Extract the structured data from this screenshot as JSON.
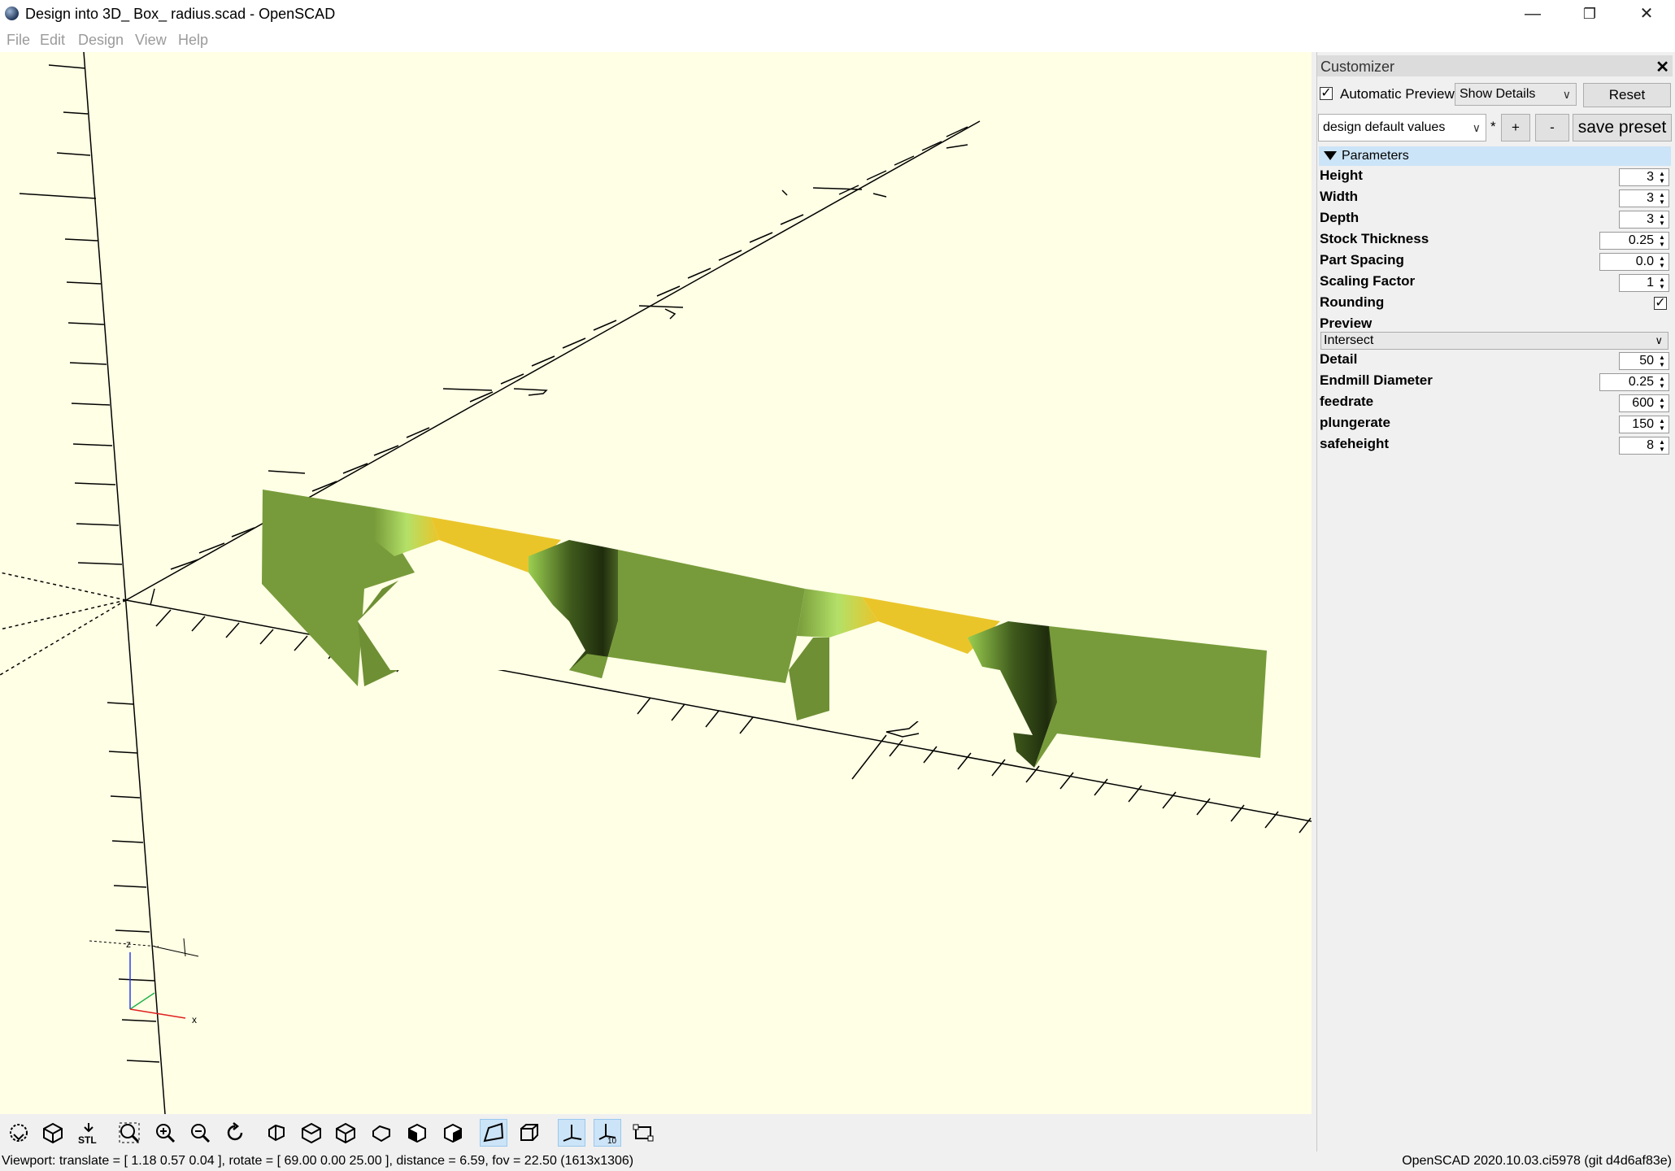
{
  "window": {
    "title": "Design into 3D_ Box_ radius.scad - OpenSCAD",
    "controls": {
      "minimize": "—",
      "restore": "❐",
      "close": "✕"
    }
  },
  "menu": [
    "File",
    "Edit",
    "Design",
    "View",
    "Help"
  ],
  "viewport": {
    "axis_labels": {
      "z": "z",
      "x": "x"
    }
  },
  "toolbar": {
    "buttons": [
      "preview-icon",
      "render-icon",
      "export-stl-icon",
      "view-all-icon",
      "zoom-in-icon",
      "zoom-out-icon",
      "reset-view-icon",
      "view-right-icon",
      "view-top-icon",
      "view-bottom-icon",
      "view-left-icon",
      "view-front-icon",
      "view-back-icon",
      "perspective-icon",
      "orthogonal-icon",
      "show-axes-icon",
      "show-scale-markers-icon",
      "show-edges-icon"
    ],
    "stl_label": "STL",
    "scale_label": "10"
  },
  "status": {
    "left": "Viewport: translate = [ 1.18 0.57 0.04 ], rotate = [ 69.00 0.00 25.00 ], distance = 6.59, fov = 22.50 (1613x1306)",
    "right": "OpenSCAD 2020.10.03.ci5978 (git d4d6af83e)"
  },
  "customizer": {
    "title": "Customizer",
    "close": "✕",
    "automatic_preview_label": "Automatic Preview",
    "automatic_preview_checked": "✓",
    "details_select": "Show Details",
    "reset_label": "Reset",
    "preset_select": "design default values",
    "preset_modified": "*",
    "add_label": "+",
    "remove_label": "-",
    "save_preset_label": "save preset",
    "parameters_label": "Parameters",
    "params": [
      {
        "name": "Height",
        "value": "3"
      },
      {
        "name": "Width",
        "value": "3"
      },
      {
        "name": "Depth",
        "value": "3"
      },
      {
        "name": "Stock Thickness",
        "value": "0.25"
      },
      {
        "name": "Part Spacing",
        "value": "0.0"
      },
      {
        "name": "Scaling Factor",
        "value": "1"
      }
    ],
    "rounding": {
      "name": "Rounding",
      "checked": "✓"
    },
    "preview": {
      "name": "Preview",
      "value": "Intersect"
    },
    "params2": [
      {
        "name": "Detail",
        "value": "50"
      },
      {
        "name": "Endmill Diameter",
        "value": "0.25"
      },
      {
        "name": "feedrate",
        "value": "600"
      },
      {
        "name": "plungerate",
        "value": "150"
      },
      {
        "name": "safeheight",
        "value": "8"
      }
    ]
  },
  "colors": {
    "viewport_bg": "#ffffe5",
    "model_green": "#779b3a",
    "model_yellow": "#eac52a",
    "accent": "#cce4f7"
  }
}
